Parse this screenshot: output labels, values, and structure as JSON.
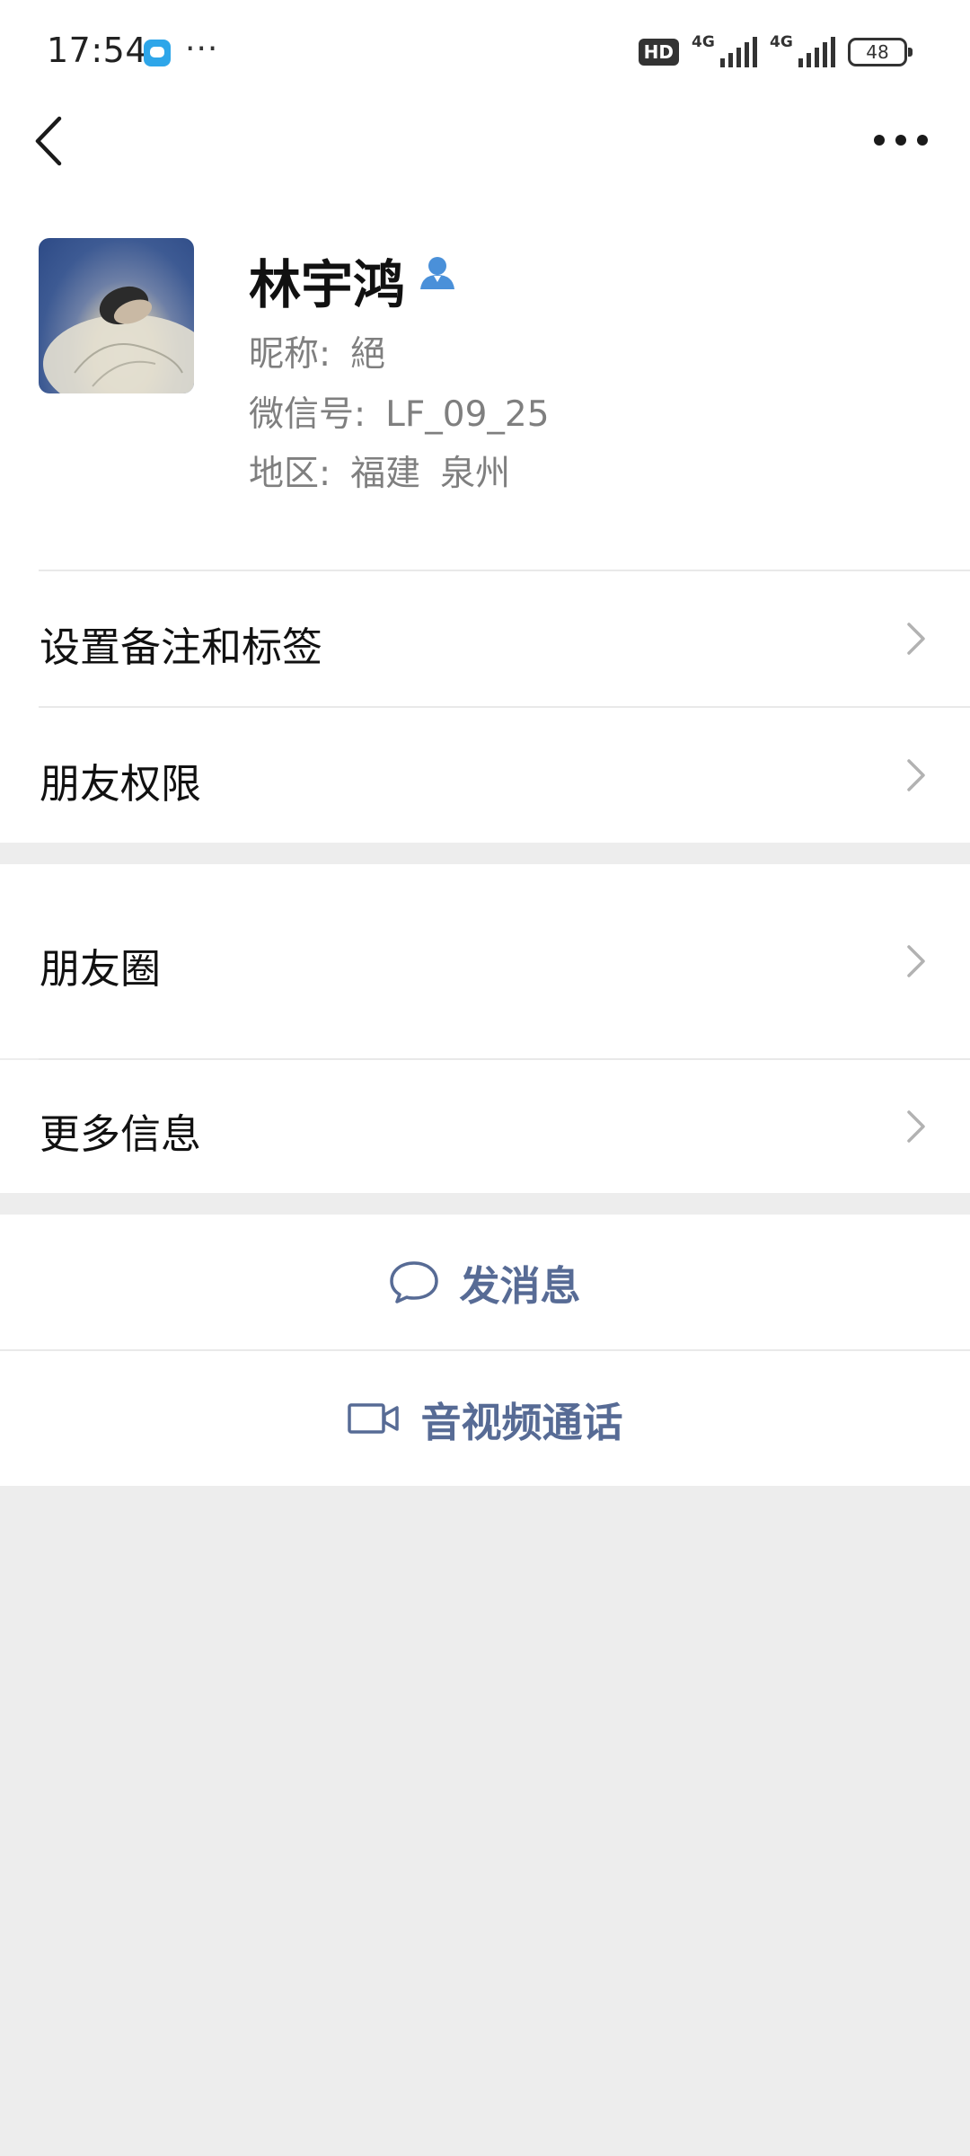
{
  "status_bar": {
    "time": "17:54",
    "more_dots": "···",
    "hd_label": "HD",
    "network1": "4G",
    "network2": "4G",
    "battery": "48"
  },
  "profile": {
    "name": "林宇鸿",
    "nickname_label": "昵称:",
    "nickname": "絕",
    "wechat_id_label": "微信号:",
    "wechat_id": "LF_09_25",
    "region_label": "地区:",
    "region_province": "福建",
    "region_city": "泉州"
  },
  "menu": {
    "set_remark": "设置备注和标签",
    "friend_permissions": "朋友权限",
    "moments": "朋友圈",
    "more_info": "更多信息"
  },
  "actions": {
    "send_message": "发消息",
    "av_call": "音视频通话"
  },
  "colors": {
    "accent": "#576b95",
    "background": "#ededed",
    "contact_icon": "#4a90d9"
  }
}
